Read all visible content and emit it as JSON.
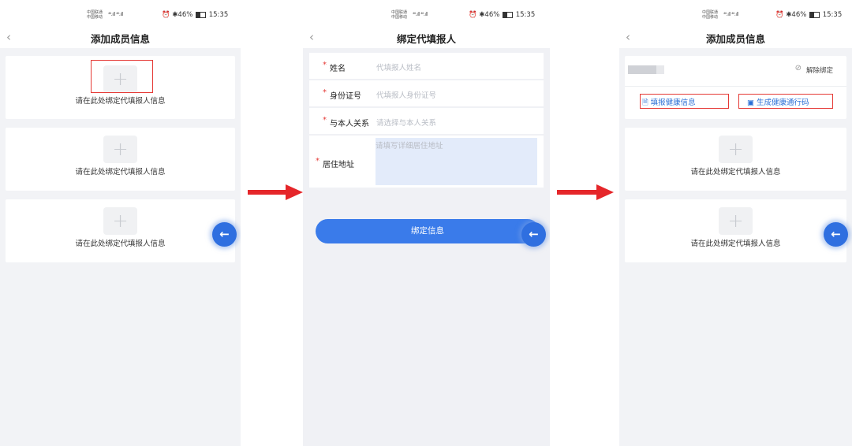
{
  "status_bar": {
    "carrier_line1": "中国联通",
    "carrier_line2": "中国移动",
    "signal": "⁴⁶.ıll ⁴⁶.ıll",
    "battery": "46%",
    "time": "15:35"
  },
  "screen1": {
    "nav_title": "添加成员信息",
    "back_icon": "‹",
    "cards": [
      {
        "label": "请在此处绑定代填报人信息"
      },
      {
        "label": "请在此处绑定代填报人信息"
      },
      {
        "label": "请在此处绑定代填报人信息"
      }
    ]
  },
  "screen2": {
    "nav_title": "绑定代填报人",
    "back_icon": "‹",
    "fields": [
      {
        "label": "姓名",
        "placeholder": "代填报人姓名"
      },
      {
        "label": "身份证号",
        "placeholder": "代填报人身份证号"
      },
      {
        "label": "与本人关系",
        "placeholder": "请选择与本人关系"
      },
      {
        "label": "居住地址",
        "placeholder": "请填写详细居住地址"
      }
    ],
    "required_mark": "*",
    "submit_label": "绑定信息"
  },
  "screen3": {
    "nav_title": "添加成员信息",
    "back_icon": "‹",
    "unbind_label": "解除绑定",
    "fill_health_label": "填报健康信息",
    "gen_pass_label": "生成健康通行码",
    "cards": [
      {
        "label": "请在此处绑定代填报人信息"
      },
      {
        "label": "请在此处绑定代填报人信息"
      }
    ]
  },
  "fab_icon": "←",
  "colors": {
    "accent": "#3a7bea",
    "highlight": "#e53935",
    "arrow": "#e5262a"
  }
}
